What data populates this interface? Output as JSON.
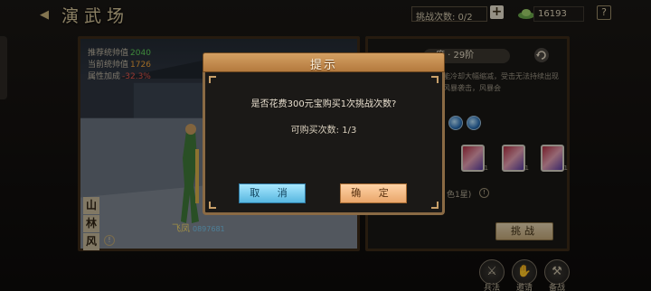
{
  "header": {
    "title": "演武场",
    "challenge_count": "挑战次数: 0/2",
    "plus": "+",
    "currency": "16193",
    "help": "?"
  },
  "left_panel": {
    "stats": [
      {
        "label": "推荐统帅值",
        "value": "2040",
        "color": "green"
      },
      {
        "label": "当前统帅值",
        "value": "1726",
        "color": "orange"
      },
      {
        "label": "属性加成",
        "value": "-32.3%",
        "color": "red"
      }
    ],
    "hero_name": "飞凤",
    "hero_id": "0897681",
    "map_tags": [
      "山",
      "林",
      "风"
    ],
    "warn": "!"
  },
  "right_panel": {
    "difficulty": "度 · 29阶",
    "description": "能冷却大幅缩减，受击无法持续出现风暴袭击，风暴会",
    "stars_note": "色1星)",
    "info": "!",
    "challenge_button": "挑战"
  },
  "bottom_nav": [
    {
      "label": "兵法",
      "icon": "war-book-icon"
    },
    {
      "label": "邀请",
      "icon": "handshake-icon"
    },
    {
      "label": "备战",
      "icon": "crossed-hammers-icon"
    }
  ],
  "dialog": {
    "title": "提示",
    "message": "是否花费300元宝购买1次挑战次数?",
    "sub": "可购买次数: 1/3",
    "cancel": "取 消",
    "confirm": "确 定"
  }
}
